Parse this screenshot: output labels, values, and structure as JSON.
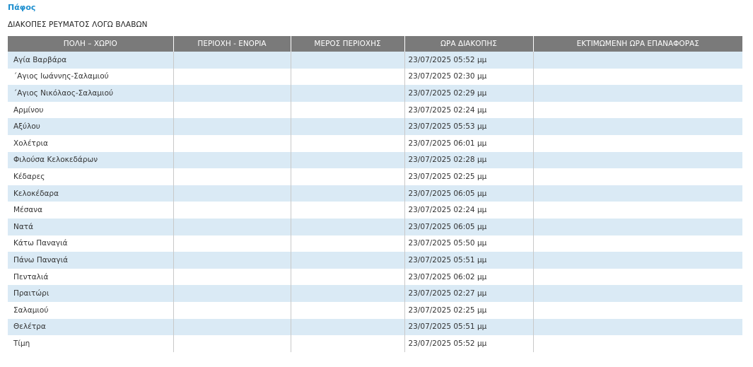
{
  "region": {
    "name": "Πάφος"
  },
  "page": {
    "heading": "ΔΙΑΚΟΠΕΣ ΡΕΥΜΑΤΟΣ ΛΟΓΩ ΒΛΑΒΩΝ"
  },
  "table": {
    "columns": [
      "ΠΟΛΗ – ΧΩΡΙΟ",
      "ΠΕΡΙΟΧΗ - ΕΝΟΡΙΑ",
      "ΜΕΡΟΣ ΠΕΡΙΟΧΗΣ",
      "ΩΡΑ ΔΙΑΚΟΠΗΣ",
      "ΕΚΤΙΜΩΜΕΝΗ ΩΡΑ ΕΠΑΝΑΦΟΡΑΣ"
    ],
    "rows": [
      {
        "village": "Αγία Βαρβάρα",
        "parish": "",
        "part": "",
        "outage_time": "23/07/2025 05:52 μμ",
        "restore_time": ""
      },
      {
        "village": "΄Αγιος Ιωάννης-Σαλαμιού",
        "parish": "",
        "part": "",
        "outage_time": "23/07/2025 02:30 μμ",
        "restore_time": ""
      },
      {
        "village": "΄Αγιος Νικόλαος-Σαλαμιού",
        "parish": "",
        "part": "",
        "outage_time": "23/07/2025 02:29 μμ",
        "restore_time": ""
      },
      {
        "village": "Αρμίνου",
        "parish": "",
        "part": "",
        "outage_time": "23/07/2025 02:24 μμ",
        "restore_time": ""
      },
      {
        "village": "Αξύλου",
        "parish": "",
        "part": "",
        "outage_time": "23/07/2025 05:53 μμ",
        "restore_time": ""
      },
      {
        "village": "Χολέτρια",
        "parish": "",
        "part": "",
        "outage_time": "23/07/2025 06:01 μμ",
        "restore_time": ""
      },
      {
        "village": "Φιλούσα Κελοκεδάρων",
        "parish": "",
        "part": "",
        "outage_time": "23/07/2025 02:28 μμ",
        "restore_time": ""
      },
      {
        "village": "Κέδαρες",
        "parish": "",
        "part": "",
        "outage_time": "23/07/2025 02:25 μμ",
        "restore_time": ""
      },
      {
        "village": "Κελοκέδαρα",
        "parish": "",
        "part": "",
        "outage_time": "23/07/2025 06:05 μμ",
        "restore_time": ""
      },
      {
        "village": "Μέσανα",
        "parish": "",
        "part": "",
        "outage_time": "23/07/2025 02:24 μμ",
        "restore_time": ""
      },
      {
        "village": "Νατά",
        "parish": "",
        "part": "",
        "outage_time": "23/07/2025 06:05 μμ",
        "restore_time": ""
      },
      {
        "village": "Κάτω Παναγιά",
        "parish": "",
        "part": "",
        "outage_time": "23/07/2025 05:50 μμ",
        "restore_time": ""
      },
      {
        "village": "Πάνω Παναγιά",
        "parish": "",
        "part": "",
        "outage_time": "23/07/2025 05:51 μμ",
        "restore_time": ""
      },
      {
        "village": "Πενταλιά",
        "parish": "",
        "part": "",
        "outage_time": "23/07/2025 06:02 μμ",
        "restore_time": ""
      },
      {
        "village": "Πραιτώρι",
        "parish": "",
        "part": "",
        "outage_time": "23/07/2025 02:27 μμ",
        "restore_time": ""
      },
      {
        "village": "Σαλαμιού",
        "parish": "",
        "part": "",
        "outage_time": "23/07/2025 02:25 μμ",
        "restore_time": ""
      },
      {
        "village": "Θελέτρα",
        "parish": "",
        "part": "",
        "outage_time": "23/07/2025 05:51 μμ",
        "restore_time": ""
      },
      {
        "village": "Τίμη",
        "parish": "",
        "part": "",
        "outage_time": "23/07/2025 05:52 μμ",
        "restore_time": ""
      }
    ]
  },
  "colors": {
    "link": "#1e8fcf",
    "header_bg": "#7a7a7a",
    "row_stripe": "#daeaf5"
  }
}
